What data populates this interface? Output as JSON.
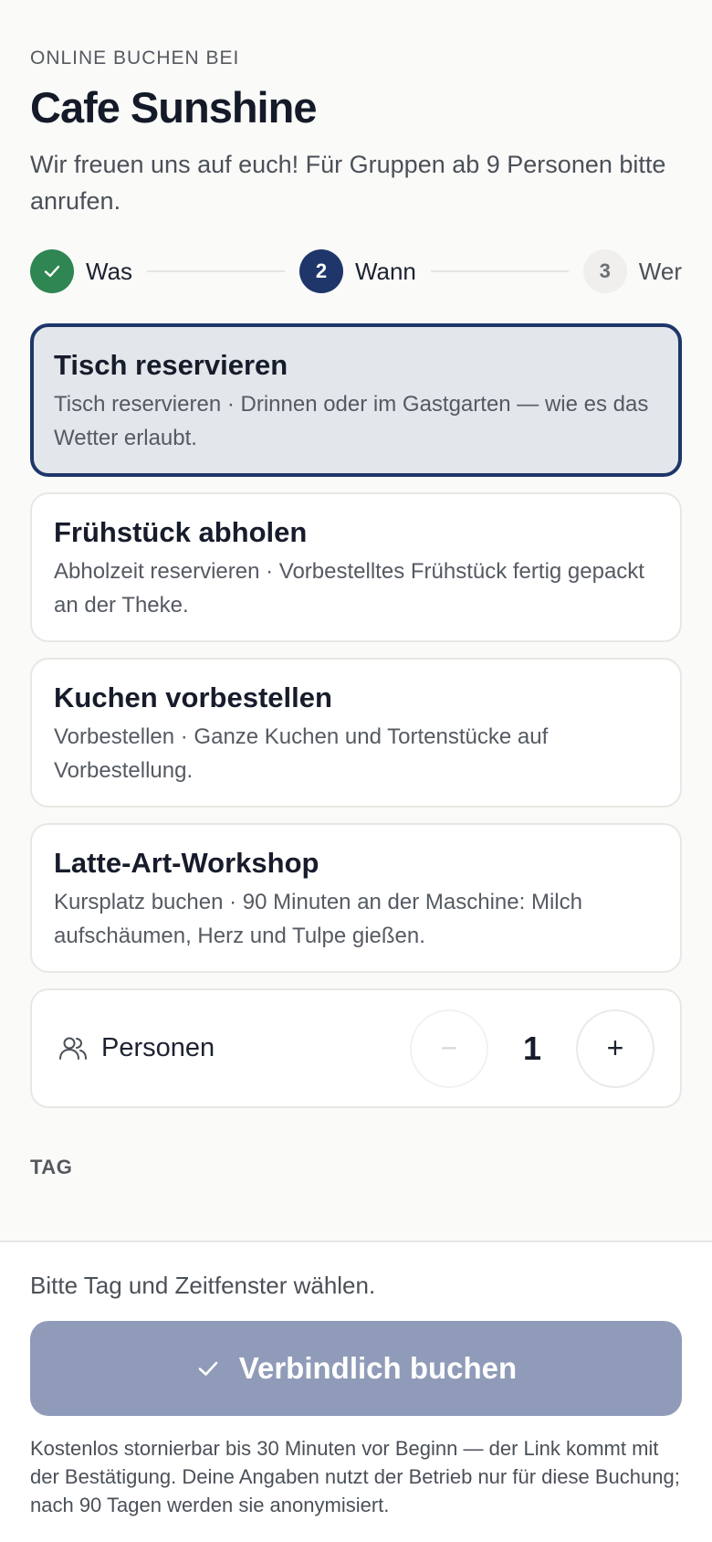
{
  "header": {
    "eyebrow": "ONLINE BUCHEN BEI",
    "title": "Cafe Sunshine",
    "subtitle": "Wir freuen uns auf euch! Für Gruppen ab 9 Personen bitte anrufen."
  },
  "steps": [
    {
      "number": "1",
      "label": "Was",
      "state": "done"
    },
    {
      "number": "2",
      "label": "Wann",
      "state": "active"
    },
    {
      "number": "3",
      "label": "Wer",
      "state": "pending"
    }
  ],
  "options": [
    {
      "title": "Tisch reservieren",
      "description": "Tisch reservieren · Drinnen oder im Gastgarten — wie es das Wetter erlaubt.",
      "selected": true
    },
    {
      "title": "Frühstück abholen",
      "description": "Abholzeit reservieren · Vorbestelltes Frühstück fertig gepackt an der Theke.",
      "selected": false
    },
    {
      "title": "Kuchen vorbestellen",
      "description": "Vorbestellen · Ganze Kuchen und Tortenstücke auf Vorbestellung.",
      "selected": false
    },
    {
      "title": "Latte-Art-Workshop",
      "description": "Kursplatz buchen · 90 Minuten an der Maschine: Milch aufschäumen, Herz und Tulpe gießen.",
      "selected": false
    }
  ],
  "persons": {
    "icon": "users-icon",
    "label": "Personen",
    "count": "1",
    "decrement": "−",
    "increment": "+"
  },
  "day_section": {
    "label": "TAG"
  },
  "footer": {
    "hint": "Bitte Tag und Zeitfenster wählen.",
    "book_label": "Verbindlich buchen",
    "fine_print": "Kostenlos stornierbar bis 30 Minuten vor Beginn — der Link kommt mit der Bestätigung. Deine Angaben nutzt der Betrieb nur für diese Buchung; nach 90 Tagen werden sie anonymisiert."
  },
  "colors": {
    "primary": "#1e3669",
    "success": "#2f8653",
    "button_disabled": "#8f9bb8"
  }
}
